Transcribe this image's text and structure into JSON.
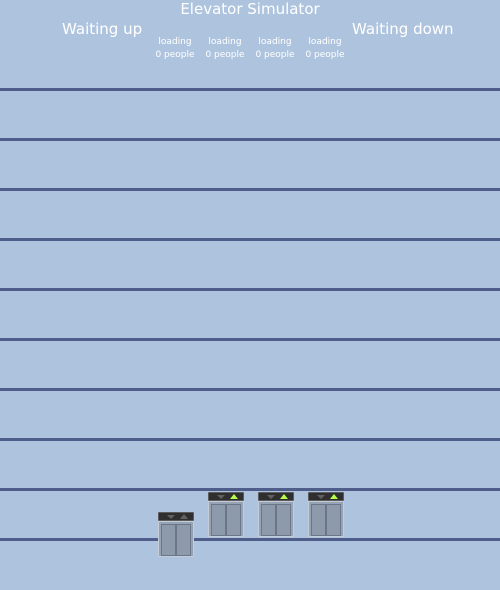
{
  "app": {
    "title": "Elevator Simulator"
  },
  "queues": {
    "up_label": "Waiting up",
    "down_label": "Waiting down"
  },
  "elevators": [
    {
      "status": "loading",
      "occupancy": "0 people",
      "up_indicator": "off",
      "down_indicator": "off"
    },
    {
      "status": "loading",
      "occupancy": "0 people",
      "up_indicator": "on",
      "down_indicator": "off"
    },
    {
      "status": "loading",
      "occupancy": "0 people",
      "up_indicator": "on",
      "down_indicator": "off"
    },
    {
      "status": "loading",
      "occupancy": "0 people",
      "up_indicator": "on",
      "down_indicator": "off"
    }
  ],
  "colors": {
    "background": "#aec4de",
    "floor_line": "#4f5d8a",
    "indicator_active": "#b6ff4c"
  }
}
